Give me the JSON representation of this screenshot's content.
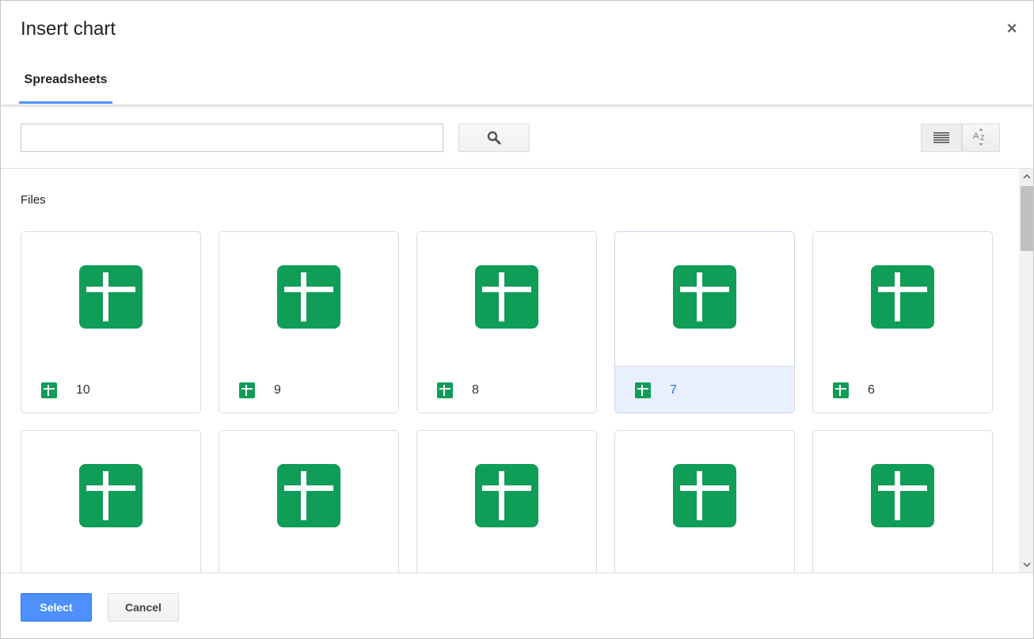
{
  "dialog": {
    "title": "Insert chart",
    "close_glyph": "×"
  },
  "tabs": [
    {
      "label": "Spreadsheets",
      "active": true
    }
  ],
  "toolbar": {
    "search_value": "",
    "search_placeholder": "",
    "search_icon": "search-icon",
    "list_view_icon": "list-view-icon",
    "sort_icon": "sort-az-icon"
  },
  "content": {
    "section_label": "Files",
    "files": [
      {
        "name": "10",
        "selected": false
      },
      {
        "name": "9",
        "selected": false
      },
      {
        "name": "8",
        "selected": false
      },
      {
        "name": "7",
        "selected": true
      },
      {
        "name": "6",
        "selected": false
      },
      {
        "name": "",
        "selected": false
      },
      {
        "name": "",
        "selected": false
      },
      {
        "name": "",
        "selected": false
      },
      {
        "name": "",
        "selected": false
      },
      {
        "name": "",
        "selected": false
      }
    ]
  },
  "footer": {
    "select_label": "Select",
    "cancel_label": "Cancel"
  },
  "colors": {
    "sheets_green": "#0f9d58",
    "primary_blue": "#4d90fe",
    "selected_bg": "#e8f0fe",
    "selected_text": "#1a73e8"
  }
}
